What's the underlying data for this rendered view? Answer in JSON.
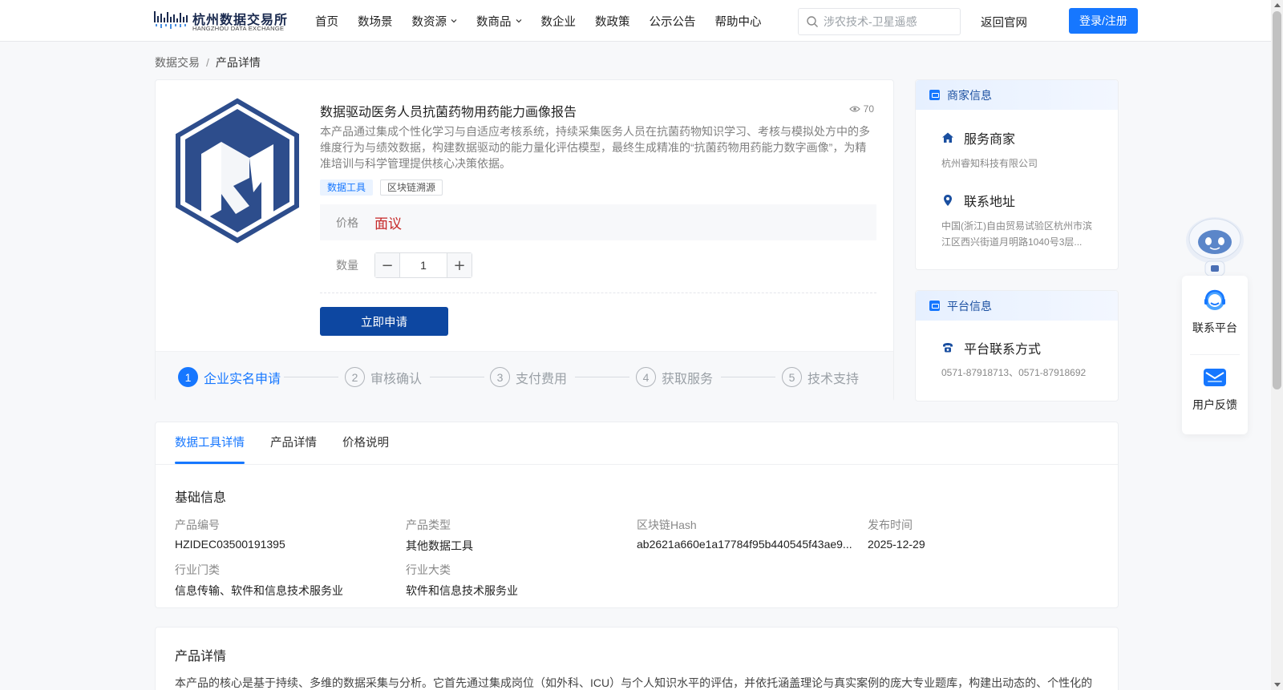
{
  "header": {
    "logo_cn": "杭州数据交易所",
    "logo_en": "HANGZHOU DATA EXCHANGE",
    "nav": [
      {
        "label": "首页"
      },
      {
        "label": "数场景"
      },
      {
        "label": "数资源"
      },
      {
        "label": "数商品"
      },
      {
        "label": "数企业"
      },
      {
        "label": "数政策"
      },
      {
        "label": "公示公告"
      },
      {
        "label": "帮助中心"
      }
    ],
    "search_placeholder": "涉农技术-卫星遥感",
    "back_label": "返回官网",
    "login_label": "登录/注册"
  },
  "breadcrumb": {
    "root": "数据交易",
    "sep": "/",
    "current": "产品详情"
  },
  "product": {
    "title": "数据驱动医务人员抗菌药物用药能力画像报告",
    "views": "70",
    "description": "本产品通过集成个性化学习与自适应考核系统，持续采集医务人员在抗菌药物知识学习、考核与模拟处方中的多维度行为与绩效数据，构建数据驱动的能力量化评估模型，最终生成精准的“抗菌药物用药能力数字画像”，为精准培训与科学管理提供核心决策依据。",
    "tags": [
      "数据工具",
      "区块链溯源"
    ],
    "price_label": "价格",
    "price_value": "面议",
    "qty_label": "数量",
    "qty_value": "1",
    "minus": "−",
    "plus": "+",
    "apply_label": "立即申请",
    "logo_text": "RM"
  },
  "steps": [
    {
      "num": "1",
      "label": "企业实名申请"
    },
    {
      "num": "2",
      "label": "审核确认"
    },
    {
      "num": "3",
      "label": "支付费用"
    },
    {
      "num": "4",
      "label": "获取服务"
    },
    {
      "num": "5",
      "label": "技术支持"
    }
  ],
  "merchant": {
    "header": "商家信息",
    "service_title": "服务商家",
    "service_value": "杭州睿知科技有限公司",
    "address_title": "联系地址",
    "address_line1": "中国(浙江)自由贸易试验区杭州市滨",
    "address_line2": "江区西兴街道月明路1040号3层..."
  },
  "platform": {
    "header": "平台信息",
    "contact_title": "平台联系方式",
    "contact_value": "0571-87918713、0571-87918692"
  },
  "tabs": [
    {
      "label": "数据工具详情"
    },
    {
      "label": "产品详情"
    },
    {
      "label": "价格说明"
    }
  ],
  "basic_info": {
    "title": "基础信息",
    "fields": [
      {
        "label": "产品编号",
        "value": "HZIDEC03500191395"
      },
      {
        "label": "产品类型",
        "value": "其他数据工具"
      },
      {
        "label": "区块链Hash",
        "value": "ab2621a660e1a17784f95b440545f43ae9..."
      },
      {
        "label": "发布时间",
        "value": "2025-12-29"
      },
      {
        "label": "行业门类",
        "value": "信息传输、软件和信息技术服务业"
      },
      {
        "label": "行业大类",
        "value": "软件和信息技术服务业"
      }
    ]
  },
  "product_detail": {
    "title": "产品详情",
    "text": "本产品的核心是基于持续、多维的数据采集与分析。它首先通过集成岗位（如外科、ICU）与个人知识水平的评估，并依托涵盖理论与真实案例的庞大专业题库，构建出动态的、个性化的"
  },
  "floating": {
    "contact_label": "联系平台",
    "feedback_label": "用户反馈"
  },
  "colors": {
    "primary": "#1677ff",
    "apply_button": "#0d47a1",
    "price": "#c62828"
  }
}
